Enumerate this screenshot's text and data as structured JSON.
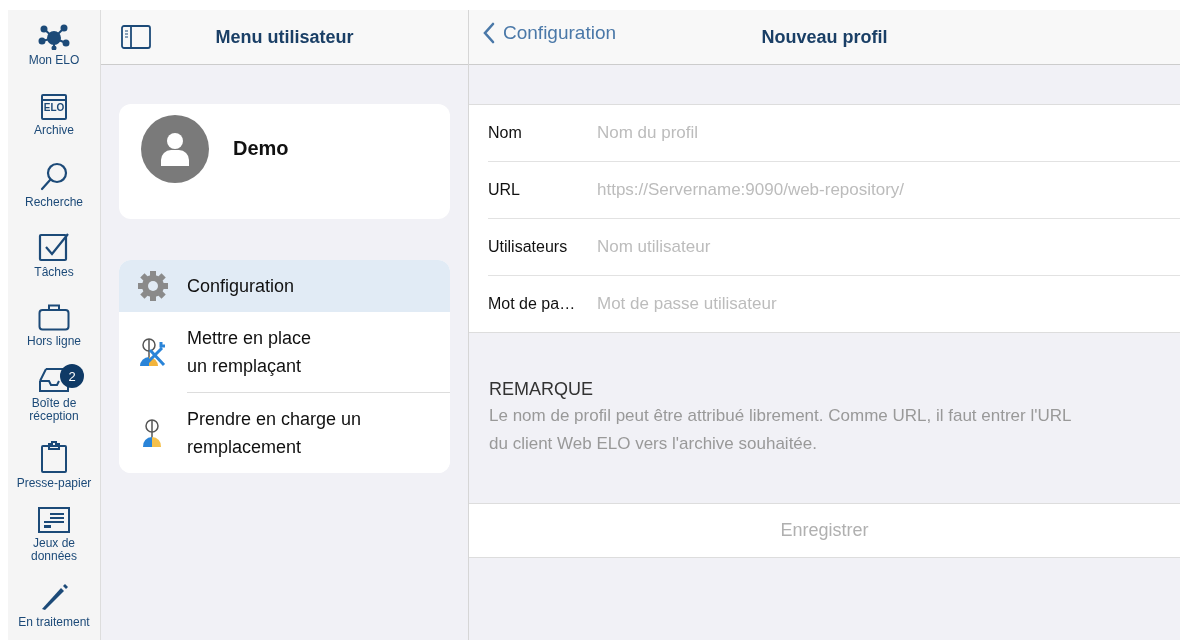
{
  "nav_rail": {
    "items": [
      {
        "label": "Mon ELO"
      },
      {
        "label": "Archive",
        "icon_text": "ELO"
      },
      {
        "label": "Recherche"
      },
      {
        "label": "Tâches"
      },
      {
        "label": "Hors ligne"
      },
      {
        "label": "Boîte de réception",
        "badge": "2"
      },
      {
        "label": "Presse-papier"
      },
      {
        "label": "Jeux de données"
      },
      {
        "label": "En traitement"
      }
    ]
  },
  "user_menu": {
    "title": "Menu utilisateur",
    "user": {
      "name": "Demo"
    },
    "items": [
      {
        "label": "Configuration",
        "selected": true
      },
      {
        "label": "Mettre en place\nun remplaçant",
        "selected": false
      },
      {
        "label": "Prendre en charge un remplacement",
        "selected": false
      }
    ]
  },
  "profile_form": {
    "back": "Configuration",
    "title": "Nouveau profil",
    "fields": [
      {
        "label": "Nom",
        "placeholder": "Nom du profil"
      },
      {
        "label": "URL",
        "placeholder": "https://Servername:9090/web-repository/"
      },
      {
        "label": "Utilisateurs",
        "placeholder": "Nom utilisateur"
      },
      {
        "label": "Mot de pa…",
        "placeholder": "Mot de passe utilisateur"
      }
    ],
    "remark_title": "REMARQUE",
    "remark_text": "Le nom de profil peut être attribué librement. Comme URL, il faut entrer l'URL du client Web ELO vers l'archive souhaitée.",
    "save_button": {
      "label": "Enregistrer",
      "disabled": true
    }
  }
}
